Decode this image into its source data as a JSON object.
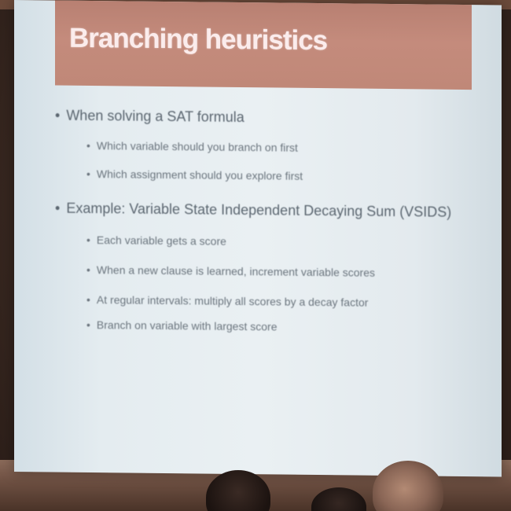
{
  "slide": {
    "title": "Branching heuristics",
    "bullets": [
      {
        "text": "When solving a SAT formula",
        "children": [
          "Which variable should you branch on first",
          "Which assignment should you explore first"
        ]
      },
      {
        "text": "Example: Variable State Independent Decaying Sum (VSIDS)",
        "children": [
          "Each variable gets a score",
          "When a new clause is learned, increment variable scores",
          "At regular intervals: multiply all scores by a decay factor",
          "Branch on variable with largest score"
        ]
      }
    ]
  },
  "colors": {
    "title_bar": "#c08878",
    "title_text": "#fbecec",
    "screen": "#e8eef2",
    "bullet_text": "#5b6670"
  }
}
